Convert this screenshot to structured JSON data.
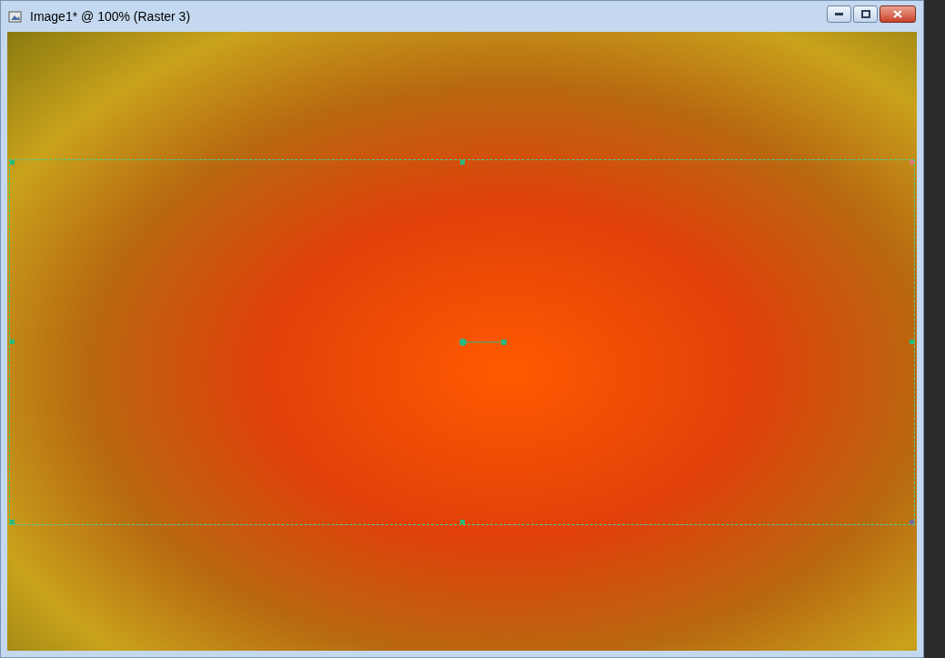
{
  "window": {
    "title": "Image1* @ 100% (Raster 3)"
  }
}
